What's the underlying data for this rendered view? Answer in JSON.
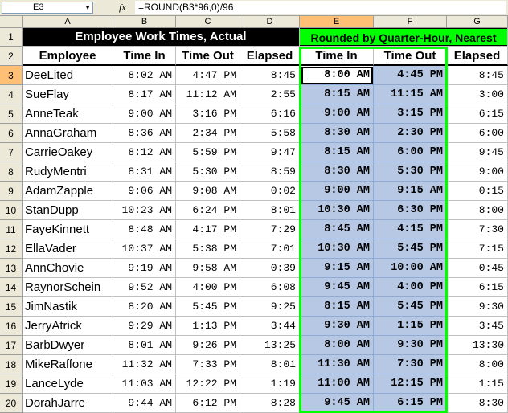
{
  "formula_bar": {
    "name_box": "E3",
    "fx_label": "fx",
    "formula": "=ROUND(B3*96,0)/96"
  },
  "columns": [
    "A",
    "B",
    "C",
    "D",
    "E",
    "F",
    "G"
  ],
  "row_numbers": [
    "1",
    "2",
    "3",
    "4",
    "5",
    "6",
    "7",
    "8",
    "9",
    "10",
    "11",
    "12",
    "13",
    "14",
    "15",
    "16",
    "17",
    "18",
    "19",
    "20"
  ],
  "titles": {
    "actual": "Employee Work Times, Actual",
    "rounded": "Rounded by Quarter-Hour, Nearest"
  },
  "headers": [
    "Employee",
    "Time In",
    "Time Out",
    "Elapsed",
    "Time In",
    "Time Out",
    "Elapsed"
  ],
  "rows": [
    [
      "DeeLited",
      "8:02 AM",
      "4:47 PM",
      "8:45",
      "8:00 AM",
      "4:45 PM",
      "8:45"
    ],
    [
      "SueFlay",
      "8:17 AM",
      "11:12 AM",
      "2:55",
      "8:15 AM",
      "11:15 AM",
      "3:00"
    ],
    [
      "AnneTeak",
      "9:00 AM",
      "3:16 PM",
      "6:16",
      "9:00 AM",
      "3:15 PM",
      "6:15"
    ],
    [
      "AnnaGraham",
      "8:36 AM",
      "2:34 PM",
      "5:58",
      "8:30 AM",
      "2:30 PM",
      "6:00"
    ],
    [
      "CarrieOakey",
      "8:12 AM",
      "5:59 PM",
      "9:47",
      "8:15 AM",
      "6:00 PM",
      "9:45"
    ],
    [
      "RudyMentri",
      "8:31 AM",
      "5:30 PM",
      "8:59",
      "8:30 AM",
      "5:30 PM",
      "9:00"
    ],
    [
      "AdamZapple",
      "9:06 AM",
      "9:08 AM",
      "0:02",
      "9:00 AM",
      "9:15 AM",
      "0:15"
    ],
    [
      "StanDupp",
      "10:23 AM",
      "6:24 PM",
      "8:01",
      "10:30 AM",
      "6:30 PM",
      "8:00"
    ],
    [
      "FayeKinnett",
      "8:48 AM",
      "4:17 PM",
      "7:29",
      "8:45 AM",
      "4:15 PM",
      "7:30"
    ],
    [
      "EllaVader",
      "10:37 AM",
      "5:38 PM",
      "7:01",
      "10:30 AM",
      "5:45 PM",
      "7:15"
    ],
    [
      "AnnChovie",
      "9:19 AM",
      "9:58 AM",
      "0:39",
      "9:15 AM",
      "10:00 AM",
      "0:45"
    ],
    [
      "RaynorSchein",
      "9:52 AM",
      "4:00 PM",
      "6:08",
      "9:45 AM",
      "4:00 PM",
      "6:15"
    ],
    [
      "JimNastik",
      "8:20 AM",
      "5:45 PM",
      "9:25",
      "8:15 AM",
      "5:45 PM",
      "9:30"
    ],
    [
      "JerryAtrick",
      "9:29 AM",
      "1:13 PM",
      "3:44",
      "9:30 AM",
      "1:15 PM",
      "3:45"
    ],
    [
      "BarbDwyer",
      "8:01 AM",
      "9:26 PM",
      "13:25",
      "8:00 AM",
      "9:30 PM",
      "13:30"
    ],
    [
      "MikeRaffone",
      "11:32 AM",
      "7:33 PM",
      "8:01",
      "11:30 AM",
      "7:30 PM",
      "8:00"
    ],
    [
      "LanceLyde",
      "11:03 AM",
      "12:22 PM",
      "1:19",
      "11:00 AM",
      "12:15 PM",
      "1:15"
    ],
    [
      "DorahJarre",
      "9:44 AM",
      "6:12 PM",
      "8:28",
      "9:45 AM",
      "6:15 PM",
      "8:30"
    ]
  ],
  "colors": {
    "highlight_green": "#00ff00",
    "rounded_fill": "#b7c8e4",
    "header_selected": "#ffc076"
  }
}
